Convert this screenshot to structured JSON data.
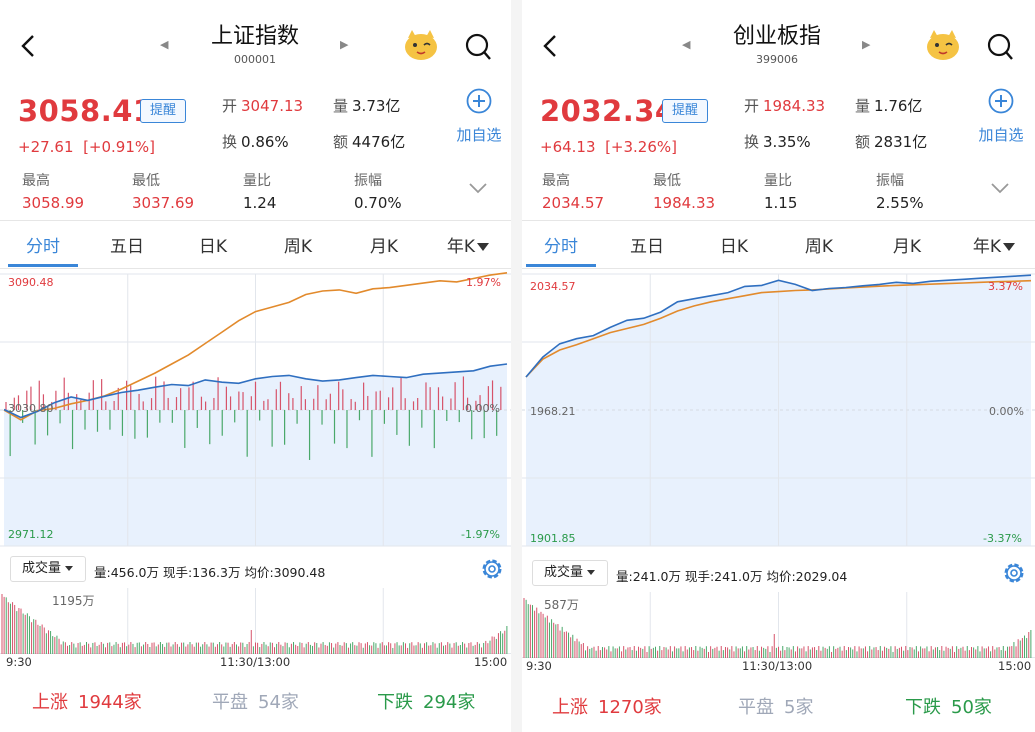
{
  "left": {
    "header": {
      "title": "上证指数",
      "code": "000001"
    },
    "quote": {
      "price": "3058.41",
      "change": "+27.61",
      "change_pct": "[+0.91%]",
      "alert_label": "提醒",
      "open_label": "开",
      "open": "3047.13",
      "volume_label": "量",
      "volume": "3.73亿",
      "turnover_label": "换",
      "turnover": "0.86%",
      "amount_label": "额",
      "amount": "4476亿",
      "add_fav_label": "加自选",
      "high_label": "最高",
      "high": "3058.99",
      "low_label": "最低",
      "low": "3037.69",
      "vol_ratio_label": "量比",
      "vol_ratio": "1.24",
      "amplitude_label": "振幅",
      "amplitude": "0.70%"
    },
    "tabs": [
      "分时",
      "五日",
      "日K",
      "周K",
      "月K",
      "年K"
    ],
    "axis": {
      "top_price": "3090.48",
      "mid_price": "3030.80",
      "bottom_price": "2971.12",
      "top_pct": "1.97%",
      "mid_pct": "0.00%",
      "bottom_pct": "-1.97%"
    },
    "info": {
      "selector": "成交量",
      "text": "量:456.0万  现手:136.3万  均价:3090.48",
      "vol_max": "1195万"
    },
    "times": {
      "open": "9:30",
      "mid": "11:30/13:00",
      "close": "15:00"
    },
    "breadth": {
      "up_label": "上涨",
      "up": "1944家",
      "flat_label": "平盘",
      "flat": "54家",
      "down_label": "下跌",
      "down": "294家"
    },
    "chart_data": {
      "type": "line",
      "title": "",
      "ylim": [
        2971.12,
        3090.48
      ],
      "series": [
        {
          "name": "",
          "color": "#2f6fc0",
          "values": [
            3031.0,
            3027.5,
            3030.2,
            3034.0,
            3036.5,
            3035.0,
            3036.8,
            3038.5,
            3039.5,
            3040.8,
            3042.0,
            3041.5,
            3044.0,
            3043.0,
            3042.5,
            3044.5,
            3045.5,
            3046.0,
            3044.5,
            3043.5,
            3044.0,
            3045.0,
            3046.0,
            3045.5,
            3045.0,
            3046.5,
            3047.0,
            3047.5,
            3048.0,
            3050.0,
            3051.0
          ]
        },
        {
          "name": "",
          "color": "#e28a2c",
          "values": [
            3030.8,
            3026.5,
            3030.5,
            3031.5,
            3033.5,
            3035.0,
            3037.0,
            3040.0,
            3043.5,
            3047.0,
            3051.0,
            3055.0,
            3060.0,
            3065.0,
            3070.0,
            3074.0,
            3076.0,
            3078.0,
            3081.5,
            3083.0,
            3083.5,
            3082.0,
            3084.0,
            3084.5,
            3085.5,
            3086.5,
            3087.5,
            3087.0,
            3088.5,
            3090.0,
            3091.0
          ]
        }
      ],
      "volume_max": 1195,
      "volume_unit": "万"
    }
  },
  "right": {
    "header": {
      "title": "创业板指",
      "code": "399006"
    },
    "quote": {
      "price": "2032.34",
      "change": "+64.13",
      "change_pct": "[+3.26%]",
      "alert_label": "提醒",
      "open_label": "开",
      "open": "1984.33",
      "volume_label": "量",
      "volume": "1.76亿",
      "turnover_label": "换",
      "turnover": "3.35%",
      "amount_label": "额",
      "amount": "2831亿",
      "add_fav_label": "加自选",
      "high_label": "最高",
      "high": "2034.57",
      "low_label": "最低",
      "low": "1984.33",
      "vol_ratio_label": "量比",
      "vol_ratio": "1.15",
      "amplitude_label": "振幅",
      "amplitude": "2.55%"
    },
    "tabs": [
      "分时",
      "五日",
      "日K",
      "周K",
      "月K",
      "年K"
    ],
    "axis": {
      "top_price": "2034.57",
      "mid_price": "1968.21",
      "bottom_price": "1901.85",
      "top_pct": "3.37%",
      "mid_pct": "0.00%",
      "bottom_pct": "-3.37%"
    },
    "info": {
      "selector": "成交量",
      "text": "量:241.0万  现手:241.0万  均价:2029.04",
      "vol_max": "587万"
    },
    "times": {
      "open": "9:30",
      "mid": "11:30/13:00",
      "close": "15:00"
    },
    "breadth": {
      "up_label": "上涨",
      "up": "1270家",
      "flat_label": "平盘",
      "flat": "5家",
      "down_label": "下跌",
      "down": "50家"
    },
    "chart_data": {
      "type": "area",
      "title": "",
      "ylim": [
        1901.85,
        2034.57
      ],
      "series": [
        {
          "name": "",
          "color": "#2f6fc0",
          "values": [
            1984.3,
            1994.0,
            2000.5,
            2003.0,
            2004.5,
            2008.5,
            2012.0,
            2013.0,
            2016.0,
            2021.0,
            2022.5,
            2024.0,
            2025.5,
            2028.5,
            2029.0,
            2031.5,
            2029.5,
            2026.5,
            2027.5,
            2028.0,
            2028.8,
            2029.5,
            2030.5,
            2030.0,
            2031.0,
            2031.5,
            2032.0,
            2032.5,
            2033.0,
            2033.5,
            2034.0
          ]
        },
        {
          "name": "",
          "color": "#e28a2c",
          "values": [
            1984.3,
            1993.0,
            1997.5,
            2000.0,
            2003.0,
            2006.0,
            2008.0,
            2010.0,
            2013.0,
            2016.5,
            2019.0,
            2021.0,
            2022.5,
            2024.0,
            2025.5,
            2026.0,
            2026.5,
            2026.8,
            2027.3,
            2027.8,
            2028.2,
            2028.6,
            2029.0,
            2029.3,
            2029.6,
            2029.9,
            2030.2,
            2030.5,
            2030.8,
            2031.0,
            2031.3
          ]
        }
      ],
      "volume_max": 587,
      "volume_unit": "万"
    }
  },
  "colors": {
    "up": "#e03a3e",
    "down": "#2a9a4a",
    "accent": "#3a86d8",
    "fill": "#e8f1fd"
  },
  "icons": {
    "back": "chevron-left-icon",
    "search": "search-icon",
    "mascot": "mascot-icon",
    "settings": "gear-icon",
    "add": "plus-circle-icon",
    "expand": "chevron-down-icon"
  }
}
